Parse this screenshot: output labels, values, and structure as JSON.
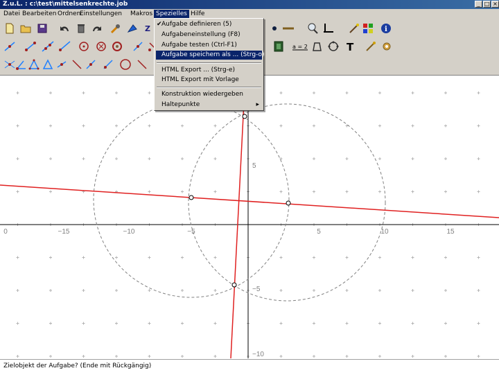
{
  "window": {
    "title": "Z.u.L. : c:\\test\\mittelsenkrechte.job"
  },
  "menubar": [
    {
      "label": "Datei"
    },
    {
      "label": "Bearbeiten"
    },
    {
      "label": "Ordnen"
    },
    {
      "label": "Einstellungen"
    },
    {
      "label": "Makros"
    },
    {
      "label": "Spezielles"
    },
    {
      "label": "Hilfe"
    }
  ],
  "dropdown": {
    "items": [
      {
        "label": "Aufgabe definieren (5)",
        "checked": true
      },
      {
        "label": "Aufgabeneinstellung    (F8)"
      },
      {
        "label": "Aufgabe testen (Ctrl-F1)"
      },
      {
        "label": "Aufgabe speichern als ... (Strg-o)",
        "highlighted": true
      },
      {
        "label": "HTML Export ... (Strg-e)"
      },
      {
        "label": "HTML Export mit Vorlage"
      },
      {
        "label": "Konstruktion wiedergeben"
      },
      {
        "label": "Haltepunkte",
        "submenu": true
      }
    ],
    "check_glyph": "✔",
    "submenu_glyph": "▸"
  },
  "statusbar": {
    "text": "Zielobjekt der Aufgabe? (Ende mit Rückgängig)"
  },
  "toolbar": {
    "text_tool_glyph": "T",
    "eq_label": "a = 2",
    "row1": [
      "new-file-icon",
      "open-folder-icon",
      "save-disk-icon",
      "undo-arrow-icon",
      "delete-icon",
      "redo-arrow-icon",
      "edit-wrench-icon",
      "color-icon",
      "z-label-icon"
    ],
    "row1_right": [
      "dot-icon",
      "line-style-icon",
      "zoom-icon",
      "axes-icon",
      "magic-wand-icon",
      "color-grid-icon",
      "info-icon"
    ],
    "row2": [
      "point-tool-icon",
      "segment-tool-icon",
      "line-tool-icon",
      "ray-tool-icon",
      "vector-tool-icon",
      "circle-tool-icon",
      "fixed-circle-icon",
      "arc-tool-icon",
      "compass-icon",
      "parallel-tool-icon"
    ],
    "row2_right": [
      "film-icon",
      "expression-icon",
      "polygon-icon",
      "fill-icon",
      "text-tool-icon",
      "macro-run-icon",
      "macro-gear-icon"
    ],
    "row3": [
      "intersect-icon",
      "angle-icon",
      "triangle-icon",
      "midpoint-icon",
      "perpendicular-icon",
      "parallel-line-icon",
      "circle-3pt-icon",
      "circle-2pt-icon",
      "diagonal-icon"
    ]
  },
  "canvas": {
    "x_ticks": [
      "0",
      "−15",
      "−10",
      "−5",
      "5",
      "10",
      "15"
    ],
    "y_ticks": [
      "5",
      "−5",
      "−10"
    ],
    "axis_color": "#000000",
    "grid_color": "#b4b4b4",
    "line_color": "#e02020",
    "circle_color": "#808080"
  }
}
